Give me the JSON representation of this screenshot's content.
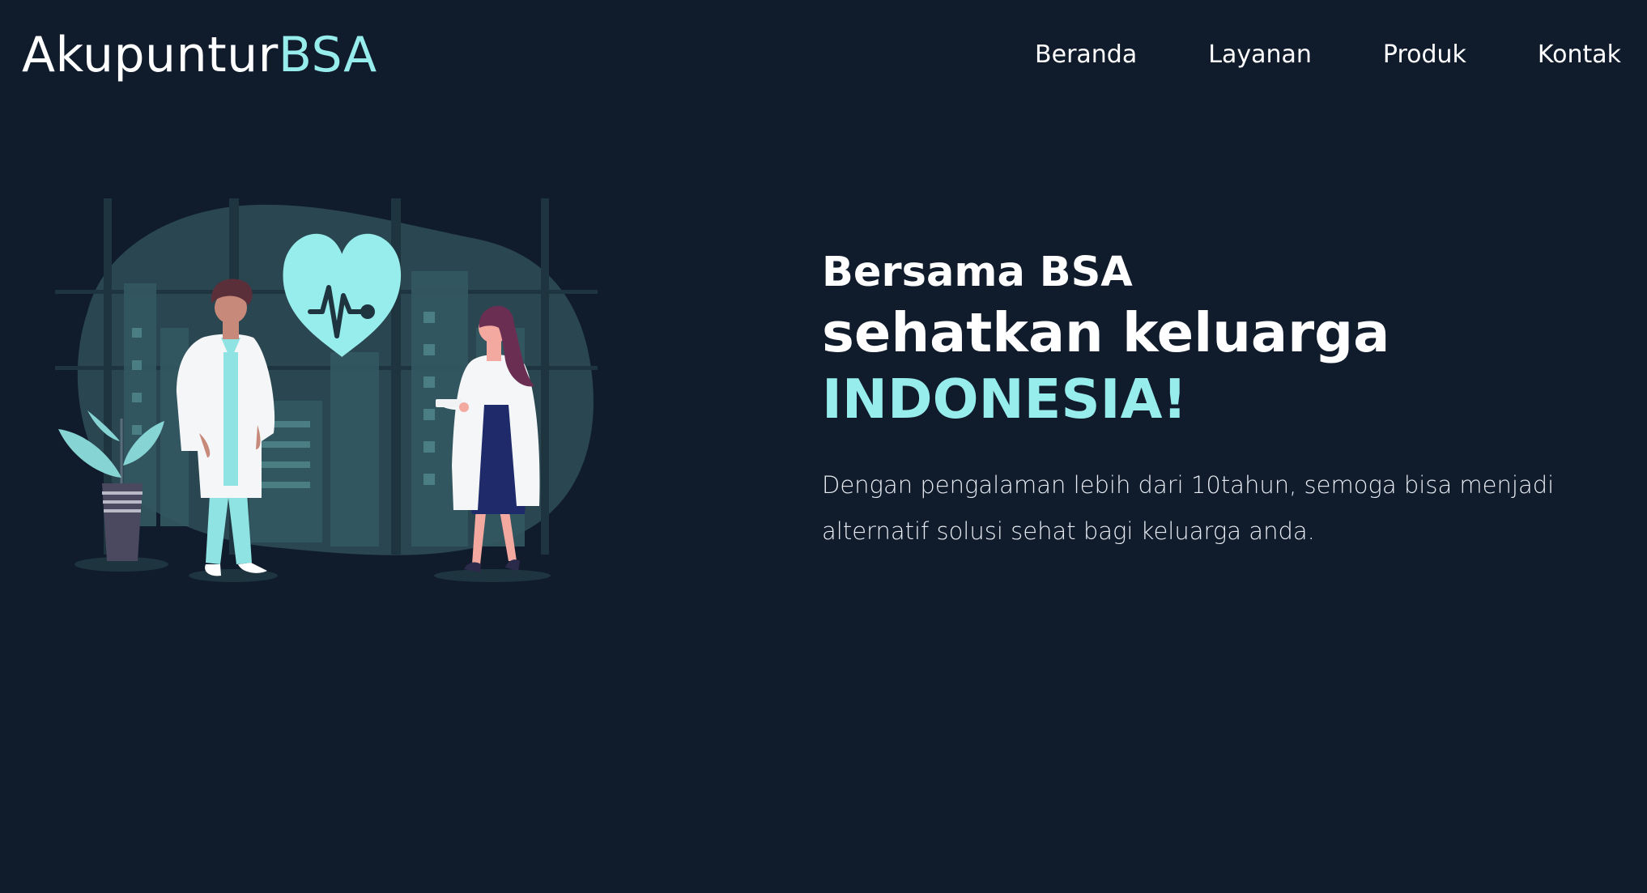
{
  "header": {
    "brand_main": "Akupuntur",
    "brand_accent": "BSA",
    "nav": [
      "Beranda",
      "Layanan",
      "Produk",
      "Kontak"
    ]
  },
  "hero": {
    "line1": "Bersama BSA",
    "line2": "sehatkan keluarga",
    "line3": "INDONESIA!",
    "description": "Dengan pengalaman lebih dari 10tahun, semoga bisa menjadi alternatif solusi sehat bagi keluarga anda.",
    "illustration": "doctors-heart-illustration"
  },
  "colors": {
    "background": "#101b2c",
    "accent": "#97ecec",
    "text": "#ffffff",
    "blob": "#2a4650"
  }
}
